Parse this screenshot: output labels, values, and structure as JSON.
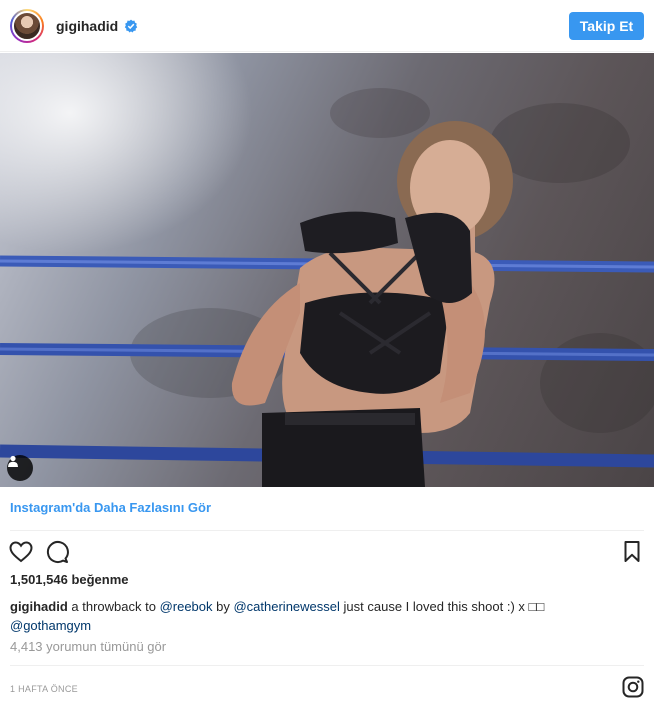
{
  "header": {
    "username": "gigihadid",
    "verified": true,
    "follow_label": "Takip Et",
    "accent": "#3897f0"
  },
  "post": {
    "image_alt": "",
    "tag_icon": "user-tag-icon"
  },
  "links": {
    "more_label": "Instagram'da Daha Fazlasını Gör"
  },
  "actions": {
    "like_icon": "heart-icon",
    "comment_icon": "comment-icon",
    "save_icon": "bookmark-icon"
  },
  "likes": {
    "text": "1,501,546 beğenme"
  },
  "caption": {
    "user": "gigihadid",
    "part1": " a throwback to ",
    "mention1": "@reebok",
    "part2": " by ",
    "mention2": "@catherinewessel",
    "part3": " just cause I loved this shoot :) x ",
    "emoji": "□□",
    "mention3": "@gothamgym"
  },
  "comments": {
    "view_all": "4,413 yorumun tümünü gör"
  },
  "footer": {
    "timestamp": "1 HAFTA ÖNCE",
    "logo_icon": "instagram-logo-icon"
  }
}
